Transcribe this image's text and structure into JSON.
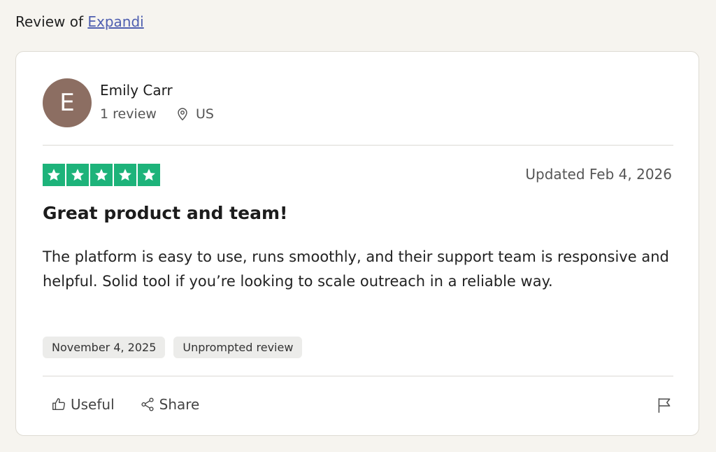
{
  "header": {
    "prefix": "Review of",
    "company_link": "Expandi"
  },
  "reviewer": {
    "initial": "E",
    "name": "Emily Carr",
    "review_count": "1 review",
    "location": "US",
    "avatar_color": "#8c6e62"
  },
  "review": {
    "rating": 5,
    "rating_max": 5,
    "updated": "Updated Feb 4, 2026",
    "title": "Great product and team!",
    "body": "The platform is easy to use, runs smoothly, and their support team is responsive and helpful. Solid tool if you’re looking to scale outreach in a reliable way.",
    "tags": [
      "November 4, 2025",
      "Unprompted review"
    ],
    "star_color": "#1db37a"
  },
  "actions": {
    "useful_label": "Useful",
    "share_label": "Share"
  },
  "icons": {
    "location": "location-pin-icon",
    "useful": "thumbs-up-icon",
    "share": "share-icon",
    "report": "flag-icon"
  }
}
